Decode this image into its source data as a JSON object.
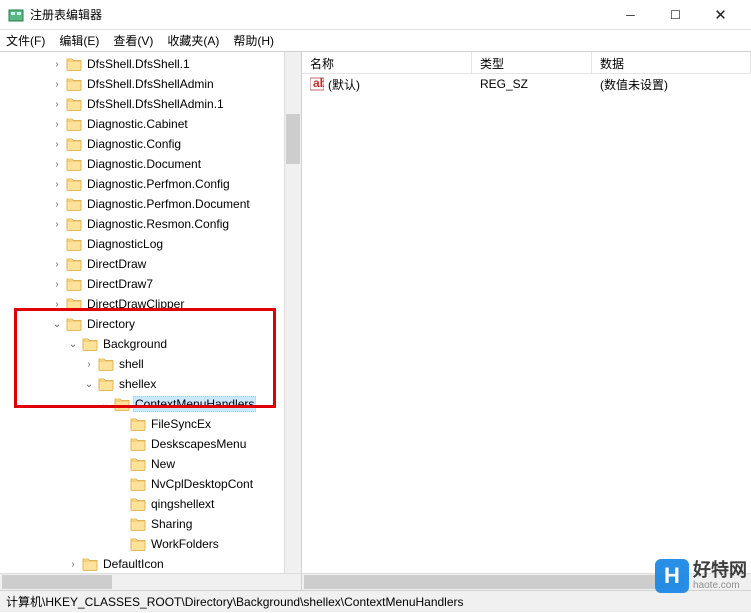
{
  "window": {
    "title": "注册表编辑器"
  },
  "menu": {
    "file": "文件(F)",
    "edit": "编辑(E)",
    "view": "查看(V)",
    "favorites": "收藏夹(A)",
    "help": "帮助(H)"
  },
  "tree": {
    "items": [
      {
        "indent": 2,
        "exp": "closed",
        "label": "DfsShell.DfsShell.1"
      },
      {
        "indent": 2,
        "exp": "closed",
        "label": "DfsShell.DfsShellAdmin"
      },
      {
        "indent": 2,
        "exp": "closed",
        "label": "DfsShell.DfsShellAdmin.1"
      },
      {
        "indent": 2,
        "exp": "closed",
        "label": "Diagnostic.Cabinet"
      },
      {
        "indent": 2,
        "exp": "closed",
        "label": "Diagnostic.Config"
      },
      {
        "indent": 2,
        "exp": "closed",
        "label": "Diagnostic.Document"
      },
      {
        "indent": 2,
        "exp": "closed",
        "label": "Diagnostic.Perfmon.Config"
      },
      {
        "indent": 2,
        "exp": "closed",
        "label": "Diagnostic.Perfmon.Document"
      },
      {
        "indent": 2,
        "exp": "closed",
        "label": "Diagnostic.Resmon.Config"
      },
      {
        "indent": 2,
        "exp": "none",
        "label": "DiagnosticLog"
      },
      {
        "indent": 2,
        "exp": "closed",
        "label": "DirectDraw"
      },
      {
        "indent": 2,
        "exp": "closed",
        "label": "DirectDraw7"
      },
      {
        "indent": 2,
        "exp": "closed",
        "label": "DirectDrawClipper"
      },
      {
        "indent": 2,
        "exp": "open",
        "label": "Directory"
      },
      {
        "indent": 3,
        "exp": "open",
        "label": "Background"
      },
      {
        "indent": 4,
        "exp": "closed",
        "label": "shell"
      },
      {
        "indent": 4,
        "exp": "open",
        "label": "shellex"
      },
      {
        "indent": 5,
        "exp": "open",
        "label": "ContextMenuHandlers",
        "selected": true
      },
      {
        "indent": 6,
        "exp": "none",
        "label": "FileSyncEx"
      },
      {
        "indent": 6,
        "exp": "none",
        "label": "DeskscapesMenu"
      },
      {
        "indent": 6,
        "exp": "none",
        "label": "New"
      },
      {
        "indent": 6,
        "exp": "none",
        "label": "NvCplDesktopCont"
      },
      {
        "indent": 6,
        "exp": "none",
        "label": "qingshellext"
      },
      {
        "indent": 6,
        "exp": "none",
        "label": "Sharing"
      },
      {
        "indent": 6,
        "exp": "none",
        "label": "WorkFolders"
      },
      {
        "indent": 3,
        "exp": "closed",
        "label": "DefaultIcon"
      }
    ]
  },
  "list": {
    "columns": {
      "name": "名称",
      "type": "类型",
      "data": "数据"
    },
    "rows": [
      {
        "name": "(默认)",
        "type": "REG_SZ",
        "data": "(数值未设置)"
      }
    ]
  },
  "statusbar": {
    "path": "计算机\\HKEY_CLASSES_ROOT\\Directory\\Background\\shellex\\ContextMenuHandlers"
  },
  "watermark": {
    "logo": "H",
    "text1": "好特网",
    "text2": "haote.com"
  }
}
